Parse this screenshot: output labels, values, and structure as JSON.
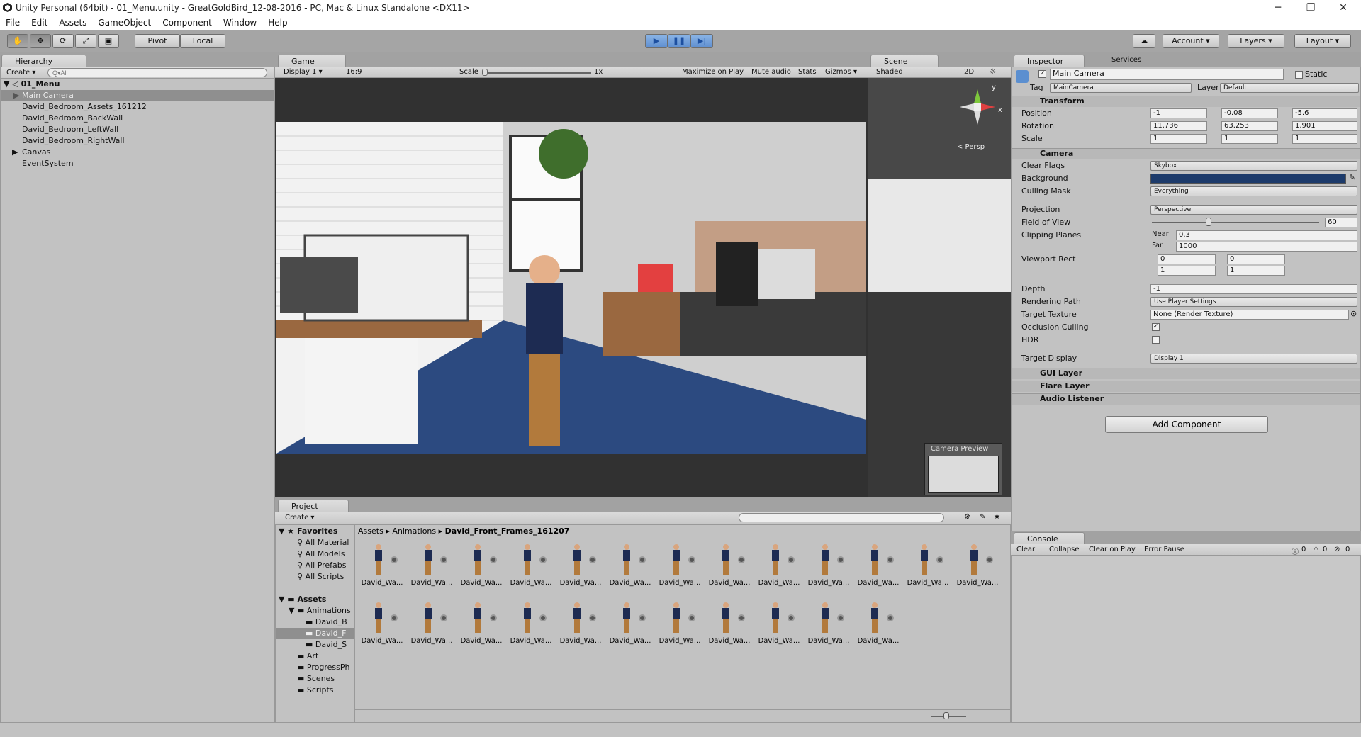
{
  "window": {
    "title": "Unity Personal (64bit) - 01_Menu.unity - GreatGoldBird_12-08-2016 - PC, Mac & Linux Standalone <DX11>",
    "minimize": "─",
    "maximize": "❐",
    "close": "✕"
  },
  "menu": [
    "File",
    "Edit",
    "Assets",
    "GameObject",
    "Component",
    "Window",
    "Help"
  ],
  "toolbar": {
    "pivot": "Pivot",
    "local": "Local",
    "account": "Account",
    "layers": "Layers",
    "layout": "Layout"
  },
  "hierarchy": {
    "tab": "Hierarchy",
    "create": "Create",
    "search_placeholder": "Q▾All",
    "scene": "01_Menu",
    "items": [
      "Main Camera",
      "David_Bedroom_Assets_161212",
      "David_Bedroom_BackWall",
      "David_Bedroom_LeftWall",
      "David_Bedroom_RightWall",
      "Canvas",
      "EventSystem"
    ]
  },
  "game": {
    "tab": "Game",
    "display": "Display 1",
    "aspect": "16:9",
    "scale_label": "Scale",
    "scale_value": "1x",
    "maximize": "Maximize on Play",
    "mute": "Mute audio",
    "stats": "Stats",
    "gizmos": "Gizmos"
  },
  "scene": {
    "tab": "Scene",
    "shading": "Shaded",
    "mode2d": "2D",
    "persp": "< Persp",
    "camera_preview": "Camera Preview",
    "axis_y": "y",
    "axis_x": "x"
  },
  "inspector": {
    "tab": "Inspector",
    "services": "Services",
    "name": "Main Camera",
    "static": "Static",
    "tag_label": "Tag",
    "tag": "MainCamera",
    "layer_label": "Layer",
    "layer": "Default",
    "transform": {
      "title": "Transform",
      "position_label": "Position",
      "rotation_label": "Rotation",
      "scale_label": "Scale",
      "position": [
        "-1",
        "-0.08",
        "-5.6"
      ],
      "rotation": [
        "11.736",
        "63.253",
        "1.901"
      ],
      "scale": [
        "1",
        "1",
        "1"
      ]
    },
    "camera": {
      "title": "Camera",
      "clear_flags_label": "Clear Flags",
      "clear_flags": "Skybox",
      "background_label": "Background",
      "culling_label": "Culling Mask",
      "culling": "Everything",
      "projection_label": "Projection",
      "projection": "Perspective",
      "fov_label": "Field of View",
      "fov": "60",
      "clipping_label": "Clipping Planes",
      "near_label": "Near",
      "near": "0.3",
      "far_label": "Far",
      "far": "1000",
      "viewport_label": "Viewport Rect",
      "vx": "0",
      "vy": "0",
      "vw": "1",
      "vh": "1",
      "depth_label": "Depth",
      "depth": "-1",
      "rendering_label": "Rendering Path",
      "rendering": "Use Player Settings",
      "target_tex_label": "Target Texture",
      "target_tex": "None (Render Texture)",
      "occlusion_label": "Occlusion Culling",
      "hdr_label": "HDR",
      "target_display_label": "Target Display",
      "target_display": "Display 1"
    },
    "components": [
      "GUI Layer",
      "Flare Layer",
      "Audio Listener"
    ],
    "add_component": "Add Component"
  },
  "project": {
    "tab": "Project",
    "create": "Create",
    "favorites": "Favorites",
    "fav_items": [
      "All Material",
      "All Models",
      "All Prefabs",
      "All Scripts"
    ],
    "assets": "Assets",
    "animations": "Animations",
    "anim_children": [
      "David_B",
      "David_F",
      "David_S"
    ],
    "asset_children": [
      "Art",
      "ProgressPh",
      "Scenes",
      "Scripts"
    ],
    "breadcrumb": [
      "Assets",
      "Animations",
      "David_Front_Frames_161207"
    ],
    "asset_label": "David_Wa..."
  },
  "console": {
    "tab": "Console",
    "clear": "Clear",
    "collapse": "Collapse",
    "clear_on_play": "Clear on Play",
    "error_pause": "Error Pause",
    "info_count": "0",
    "warn_count": "0",
    "err_count": "0"
  },
  "colors": {
    "background": "#1d3b6b",
    "carpet": "#2c4a80"
  }
}
